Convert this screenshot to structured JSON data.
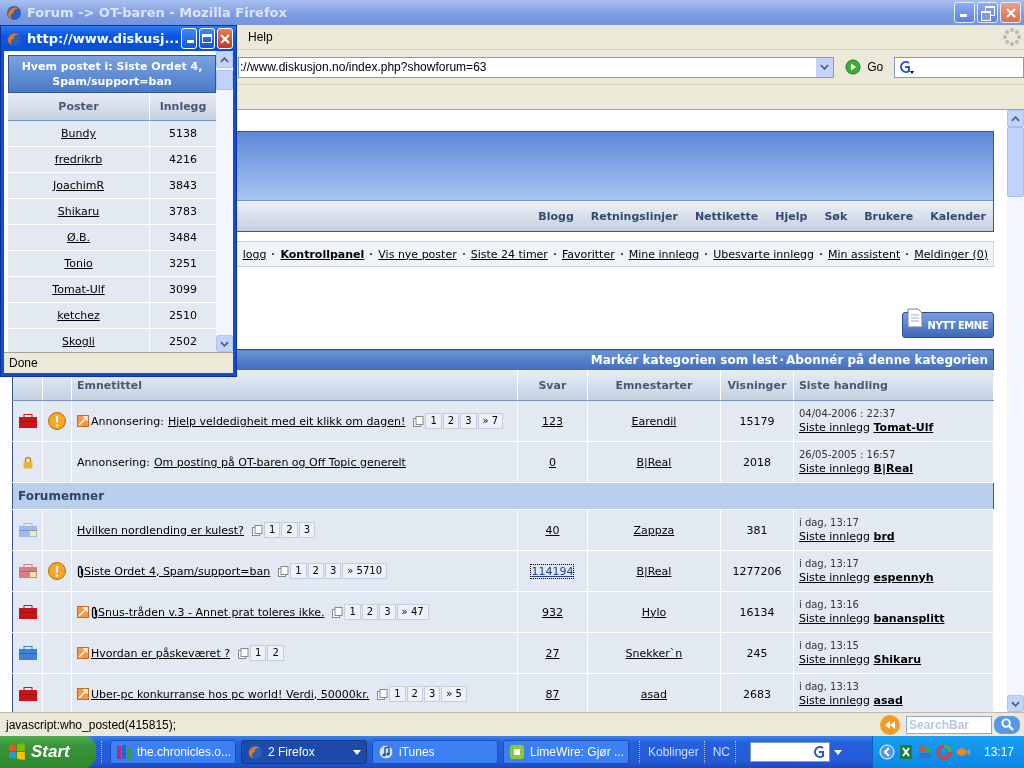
{
  "window": {
    "title": "Forum -> OT-baren - Mozilla Firefox"
  },
  "menu": [
    "Help"
  ],
  "address_bar": {
    "value": "://www.diskusjon.no/index.php?showforum=63",
    "go": "Go"
  },
  "header_nav": [
    "Blogg",
    "Retningslinjer",
    "Nettikette",
    "Hjelp",
    "Søk",
    "Brukere",
    "Kalender"
  ],
  "user_nav": [
    {
      "label": "logg",
      "selected": false
    },
    {
      "label": "Kontrollpanel",
      "selected": true
    },
    {
      "label": "Vis nye poster",
      "selected": false
    },
    {
      "label": "Siste 24 timer",
      "selected": false
    },
    {
      "label": "Favoritter",
      "selected": false
    },
    {
      "label": "Mine innlegg",
      "selected": false
    },
    {
      "label": "Ubesvarte innlegg",
      "selected": false
    },
    {
      "label": "Min assistent",
      "selected": false
    },
    {
      "label": "Meldinger (0)",
      "selected": false
    }
  ],
  "new_topic_button": "NYTT EMNE",
  "forum": {
    "actions": [
      "Markér kategorien som lest",
      "Abonnér på denne kategorien"
    ],
    "actions_separator": "·",
    "columns": [
      "Emnetittel",
      "Svar",
      "Emnestarter",
      "Visninger",
      "Siste handling"
    ],
    "announcements": [
      {
        "kind": "hot",
        "flag": true,
        "new_post": true,
        "attachment": false,
        "prefix": "Annonsering:",
        "title": "Hjelp veldedigheit med eit klikk om dagen!",
        "pages": [
          "1",
          "2",
          "3",
          "» 7"
        ],
        "replies": "123",
        "focused": false,
        "starter": "Earendil",
        "views": "15179",
        "last_date": "04/04-2006 : 22:37",
        "last_label": "Siste innlegg",
        "last_poster": "Tomat-Ulf"
      },
      {
        "kind": "locked",
        "flag": false,
        "new_post": false,
        "attachment": false,
        "prefix": "Annonsering:",
        "title": "Om posting på OT-baren og Off Topic generelt",
        "replies": "0",
        "focused": false,
        "starter": "B|Real",
        "views": "2018",
        "last_date": "26/05-2005 : 16:57",
        "last_label": "Siste innlegg",
        "last_poster": "B|Real"
      }
    ],
    "topics_header": "Forumemner",
    "topics": [
      {
        "kind": "new",
        "flag": false,
        "new_post": false,
        "attachment": false,
        "title": "Hvilken nordlending er kulest?",
        "pages": [
          "1",
          "2",
          "3"
        ],
        "replies": "40",
        "focused": false,
        "starter": "Zappza",
        "views": "381",
        "last_date": "i dag, 13:17",
        "last_label": "Siste innlegg",
        "last_poster": "brd"
      },
      {
        "kind": "hot_new",
        "flag": true,
        "new_post": false,
        "attachment": true,
        "title": "Siste Ordet 4, Spam/support=ban",
        "pages": [
          "1",
          "2",
          "3",
          "» 5710"
        ],
        "replies": "114194",
        "focused": true,
        "starter": "B|Real",
        "views": "1277206",
        "last_date": "i dag, 13:17",
        "last_label": "Siste innlegg",
        "last_poster": "espennyh"
      },
      {
        "kind": "hot",
        "flag": false,
        "new_post": true,
        "attachment": true,
        "title": "Snus-tråden v.3 - Annet prat toleres ikke.",
        "pages": [
          "1",
          "2",
          "3",
          "» 47"
        ],
        "replies": "932",
        "focused": false,
        "starter": "Hylo",
        "views": "16134",
        "last_date": "i dag, 13:16",
        "last_label": "Siste innlegg",
        "last_poster": "banansplitt"
      },
      {
        "kind": "normal",
        "flag": false,
        "new_post": true,
        "attachment": false,
        "title": "Hvordan er påskeværet ?",
        "pages": [
          "1",
          "2"
        ],
        "replies": "27",
        "focused": false,
        "starter": "Snekker`n",
        "views": "245",
        "last_date": "i dag, 13:15",
        "last_label": "Siste innlegg",
        "last_poster": "Shikaru"
      },
      {
        "kind": "hot",
        "flag": false,
        "new_post": true,
        "attachment": false,
        "title": "Uber-pc konkurranse hos pc world! Verdi, 50000kr.",
        "pages": [
          "1",
          "2",
          "3",
          "» 5"
        ],
        "replies": "87",
        "focused": false,
        "starter": "asad",
        "views": "2683",
        "last_date": "i dag, 13:13",
        "last_label": "Siste innlegg",
        "last_poster": "asad"
      }
    ]
  },
  "status_bar": {
    "text": "javascript:who_posted(415815);",
    "search_placeholder": "SearchBar"
  },
  "popup": {
    "title": "http://www.diskusj...",
    "heading": "Hvem postet i: Siste Ordet 4, Spam/support=ban",
    "columns": [
      "Poster",
      "Innlegg"
    ],
    "rows": [
      {
        "poster": "Bundy",
        "posts": "5138"
      },
      {
        "poster": "fredrikrb",
        "posts": "4216"
      },
      {
        "poster": "JoachimR",
        "posts": "3843"
      },
      {
        "poster": "Shikaru",
        "posts": "3783"
      },
      {
        "poster": "Ø.B.",
        "posts": "3484"
      },
      {
        "poster": "Tonio",
        "posts": "3251"
      },
      {
        "poster": "Tomat-Ulf",
        "posts": "3099"
      },
      {
        "poster": "ketchez",
        "posts": "2510"
      },
      {
        "poster": "Skogli",
        "posts": "2502"
      }
    ],
    "status": "Done"
  },
  "taskbar": {
    "start": "Start",
    "items": [
      {
        "label": "the.chronicles.o...",
        "kind": "archive",
        "selected": false,
        "menu": false
      },
      {
        "label": "2 Firefox",
        "kind": "browser",
        "selected": true,
        "menu": true
      },
      {
        "label": "iTunes",
        "kind": "music",
        "selected": false,
        "menu": false
      },
      {
        "label": "LimeWire: Gjør ...",
        "kind": "lime",
        "selected": false,
        "menu": false
      }
    ],
    "toolbars": [
      "Koblinger",
      "NC"
    ],
    "clock": "13:17"
  }
}
